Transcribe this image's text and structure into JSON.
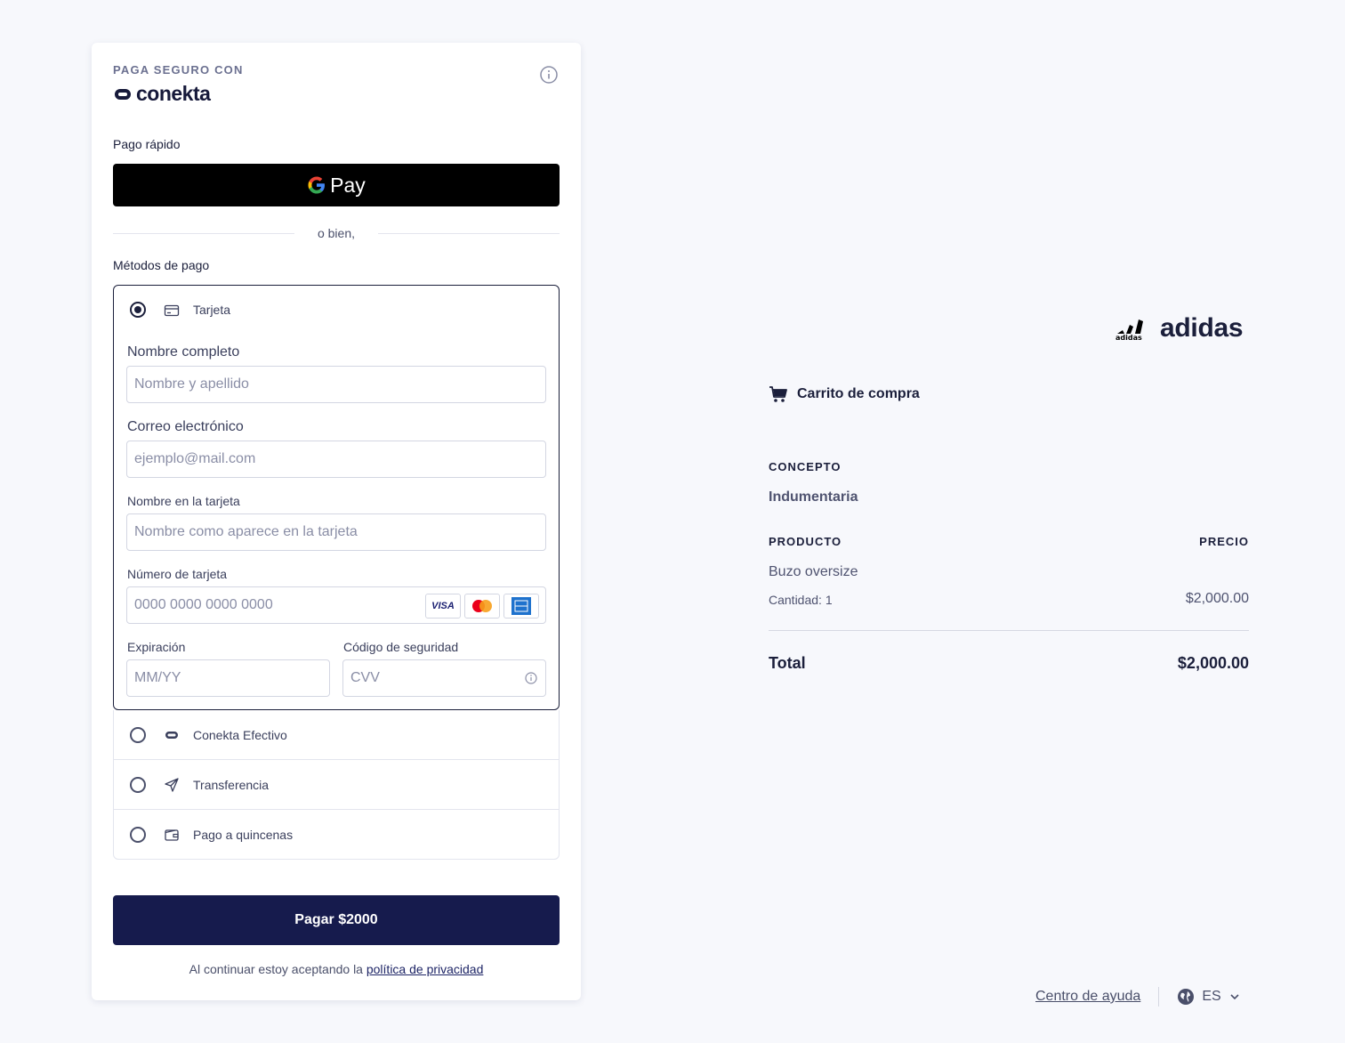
{
  "header": {
    "secure_label": "PAGA SEGURO CON",
    "provider_name": "conekta"
  },
  "quick_pay": {
    "label": "Pago rápido",
    "gpay_label": "Pay",
    "separator": "o bien,"
  },
  "methods": {
    "title": "Métodos de pago",
    "card": {
      "label": "Tarjeta",
      "full_name_label": "Nombre completo",
      "full_name_placeholder": "Nombre y apellido",
      "email_label": "Correo electrónico",
      "email_placeholder": "ejemplo@mail.com",
      "card_name_label": "Nombre en la tarjeta",
      "card_name_placeholder": "Nombre como aparece en la tarjeta",
      "card_number_label": "Número de tarjeta",
      "card_number_placeholder": "0000 0000 0000 0000",
      "expiry_label": "Expiración",
      "expiry_placeholder": "MM/YY",
      "cvv_label": "Código de seguridad",
      "cvv_placeholder": "CVV",
      "brands": [
        "VISA",
        "mastercard",
        "amex"
      ]
    },
    "others": [
      {
        "label": "Conekta Efectivo",
        "icon": "conekta-cash-icon"
      },
      {
        "label": "Transferencia",
        "icon": "send-icon"
      },
      {
        "label": "Pago a quincenas",
        "icon": "wallet-icon"
      }
    ]
  },
  "pay_button": "Pagar $2000",
  "terms": {
    "prefix": "Al continuar estoy aceptando la",
    "link": "política de privacidad"
  },
  "merchant": {
    "name": "adidas"
  },
  "cart": {
    "title": "Carrito de compra",
    "concept_label": "CONCEPTO",
    "concept_value": "Indumentaria",
    "product_label": "PRODUCTO",
    "price_label": "PRECIO",
    "product_name": "Buzo oversize",
    "quantity": "Cantidad: 1",
    "price": "$2,000.00",
    "total_label": "Total",
    "total_value": "$2,000.00"
  },
  "footer": {
    "help": "Centro de ayuda",
    "language": "ES"
  },
  "colors": {
    "primary": "#161b4d",
    "background": "#f7f8fc",
    "text": "#1b1f3b"
  }
}
